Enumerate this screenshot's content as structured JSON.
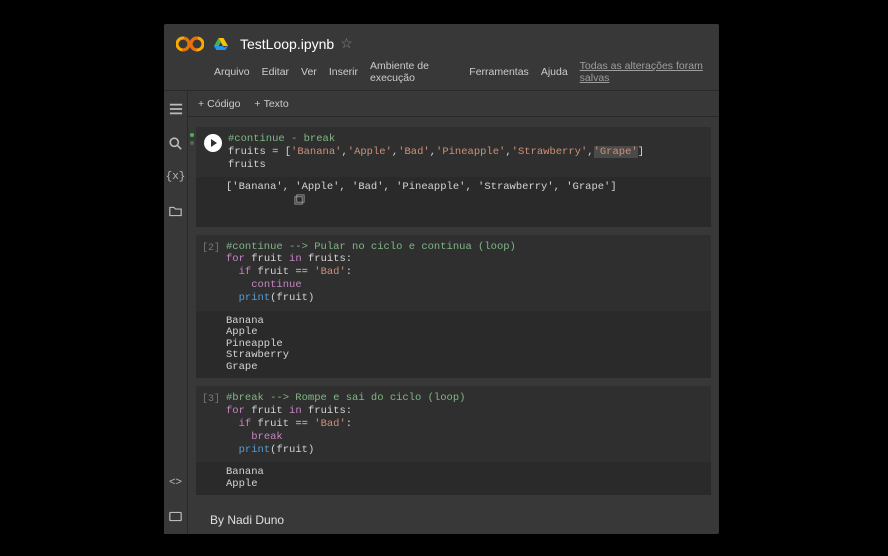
{
  "header": {
    "notebook_title": "TestLoop.ipynb"
  },
  "menu": {
    "file": "Arquivo",
    "edit": "Editar",
    "view": "Ver",
    "insert": "Inserir",
    "runtime": "Ambiente de execução",
    "tools": "Ferramentas",
    "help": "Ajuda",
    "save_status": "Todas as alterações foram salvas"
  },
  "toolbar": {
    "code": "Código",
    "text": "Texto"
  },
  "cells": [
    {
      "exec": "",
      "selected": true,
      "code_html": "<span class=\"c-comment\">#continue - break</span>\n<span class=\"c-ident\">fruits</span> = [<span class=\"c-string\">'Banana'</span>,<span class=\"c-string\">'Apple'</span>,<span class=\"c-string\">'Bad'</span>,<span class=\"c-string\">'Pineapple'</span>,<span class=\"c-string\">'Strawberry'</span>,<span class=\"c-string-hl\">'Grape'</span>]\n<span class=\"c-ident\">fruits</span>",
      "output": "['Banana', 'Apple', 'Bad', 'Pineapple', 'Strawberry', 'Grape']",
      "out_icon": true
    },
    {
      "exec": "[2]",
      "code_html": "<span class=\"c-comment\">#continue --&gt; Pular no ciclo e continua (loop)</span>\n<span class=\"c-keyword\">for</span> <span class=\"c-ident\">fruit</span> <span class=\"c-keyword\">in</span> <span class=\"c-ident\">fruits</span>:\n  <span class=\"c-keyword\">if</span> <span class=\"c-ident\">fruit</span> == <span class=\"c-string\">'Bad'</span>:\n    <span class=\"c-keyword\">continue</span>\n  <span class=\"c-builtin\">print</span>(<span class=\"c-ident\">fruit</span>)",
      "output": "Banana\nApple\nPineapple\nStrawberry\nGrape"
    },
    {
      "exec": "[3]",
      "code_html": "<span class=\"c-comment\">#break --&gt; Rompe e sai do ciclo (loop)</span>\n<span class=\"c-keyword\">for</span> <span class=\"c-ident\">fruit</span> <span class=\"c-keyword\">in</span> <span class=\"c-ident\">fruits</span>:\n  <span class=\"c-keyword\">if</span> <span class=\"c-ident\">fruit</span> == <span class=\"c-string\">'Bad'</span>:\n    <span class=\"c-keyword\">break</span>\n  <span class=\"c-builtin\">print</span>(<span class=\"c-ident\">fruit</span>)",
      "output": "Banana\nApple"
    }
  ],
  "text_cell": {
    "content": "By Nadi Duno"
  }
}
